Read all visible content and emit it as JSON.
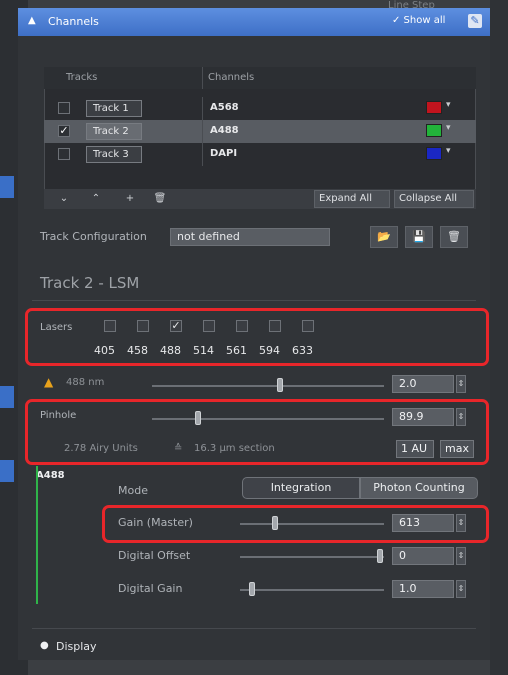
{
  "background": {
    "right_ghost_text": "Line Step"
  },
  "titlebar": {
    "collapse_icon": "▲",
    "title": "Channels",
    "show_all": "✓ Show all",
    "show_all_icon": "✎"
  },
  "tracks": {
    "headers": {
      "tracks": "Tracks",
      "channels": "Channels"
    },
    "rows": [
      {
        "checked": "",
        "name": "Track 1",
        "channel": "A568",
        "color": "#c2141e",
        "dropdown": "▾"
      },
      {
        "checked": "✓",
        "name": "Track 2",
        "channel": "A488",
        "color": "#22b33a",
        "dropdown": "▾"
      },
      {
        "checked": "",
        "name": "Track 3",
        "channel": "DAPI",
        "color": "#1a27c4",
        "dropdown": "▾"
      }
    ],
    "toolbar": {
      "down": "⌄",
      "up": "⌃",
      "add": "+",
      "delete": "🗑",
      "expand_all": "Expand All",
      "collapse_all": "Collapse All"
    }
  },
  "track_config": {
    "label": "Track Configuration",
    "value": "not defined",
    "open_icon": "📂",
    "save_icon": "💾",
    "delete_icon": "🗑"
  },
  "section_title": "Track 2 - LSM",
  "lasers": {
    "label": "Lasers",
    "items": [
      {
        "wl": "405",
        "checked": ""
      },
      {
        "wl": "458",
        "checked": ""
      },
      {
        "wl": "488",
        "checked": "✓"
      },
      {
        "wl": "514",
        "checked": ""
      },
      {
        "wl": "561",
        "checked": ""
      },
      {
        "wl": "594",
        "checked": ""
      },
      {
        "wl": "633",
        "checked": ""
      }
    ]
  },
  "laser_power": {
    "warning_icon": "▲",
    "label": "488 nm",
    "value": "2.0",
    "spin": "⇕",
    "level": 0.55
  },
  "pinhole": {
    "label": "Pinhole",
    "value": "89.9",
    "spin": "⇕",
    "level": 0.2,
    "airy": "2.78 Airy Units",
    "approx": "≙",
    "section": "16.3 µm section",
    "btn_1au": "1 AU",
    "btn_max": "max"
  },
  "channel": {
    "name": "A488",
    "mode_label": "Mode",
    "mode_integration": "Integration",
    "mode_photon": "Photon Counting",
    "gain": {
      "label": "Gain (Master)",
      "value": "613",
      "spin": "⇕",
      "level": 0.24
    },
    "offset": {
      "label": "Digital Offset",
      "value": "0",
      "spin": "⇕",
      "level": 0.97
    },
    "dgain": {
      "label": "Digital Gain",
      "value": "1.0",
      "spin": "⇕",
      "level": 0.08
    }
  },
  "display": {
    "icon": "●",
    "label": "Display"
  }
}
